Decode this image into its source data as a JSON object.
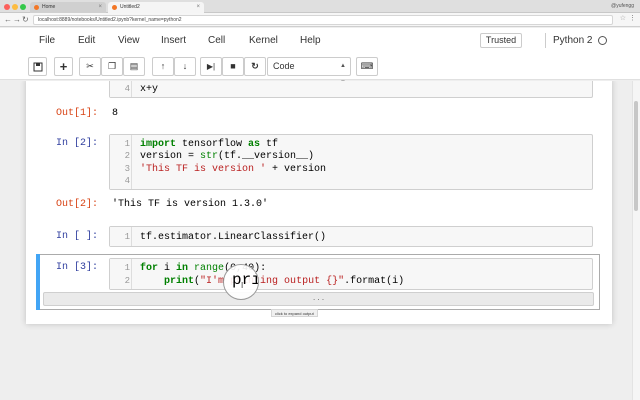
{
  "browser": {
    "tabs": [
      {
        "label": "Home"
      },
      {
        "label": "Untitled2"
      }
    ],
    "user_badge": "@yufengg",
    "url": "localhost:8889/notebooks/Untitled2.ipynb?kernel_name=python2"
  },
  "menubar": {
    "items": [
      "File",
      "Edit",
      "View",
      "Insert",
      "Cell",
      "Kernel",
      "Help"
    ],
    "trusted_label": "Trusted",
    "kernel_name": "Python 2"
  },
  "toolbar": {
    "cell_type": "Code"
  },
  "cells": {
    "c1": {
      "line_number": "4",
      "code": "x+y",
      "out_prompt": "Out[1]:",
      "output": "8"
    },
    "c2": {
      "in_prompt": "In [2]:",
      "line_numbers": [
        "1",
        "2",
        "3",
        "4"
      ],
      "lines": {
        "l1_kw_import": "import",
        "l1_mod": " tensorflow ",
        "l1_kw_as": "as",
        "l1_alias": " tf",
        "l2_pre": "version = ",
        "l2_builtin": "str",
        "l2_post": "(tf.__version__)",
        "l3_str": "'This TF is version '",
        "l3_post": " + version"
      },
      "out_prompt": "Out[2]:",
      "output": "'This TF is version 1.3.0'"
    },
    "c3": {
      "in_prompt": "In [ ]:",
      "line_number": "1",
      "code": "tf.estimator.LinearClassifier()"
    },
    "c4": {
      "in_prompt": "In [3]:",
      "line_numbers": [
        "1",
        "2"
      ],
      "lines": {
        "l1_kw_for": "for",
        "l1_i": " i ",
        "l1_kw_in": "in",
        "l1_range": " range",
        "l1_args": "(0,40):",
        "l2_indent": "    ",
        "l2_print": "print",
        "l2_paren": "(",
        "l2_str": "\"I'm printing output {}\"",
        "l2_post": ".format(i)"
      },
      "collapsed_label": ". . .",
      "tooltip": "click to expand output",
      "magnifier_text": "pri"
    }
  }
}
